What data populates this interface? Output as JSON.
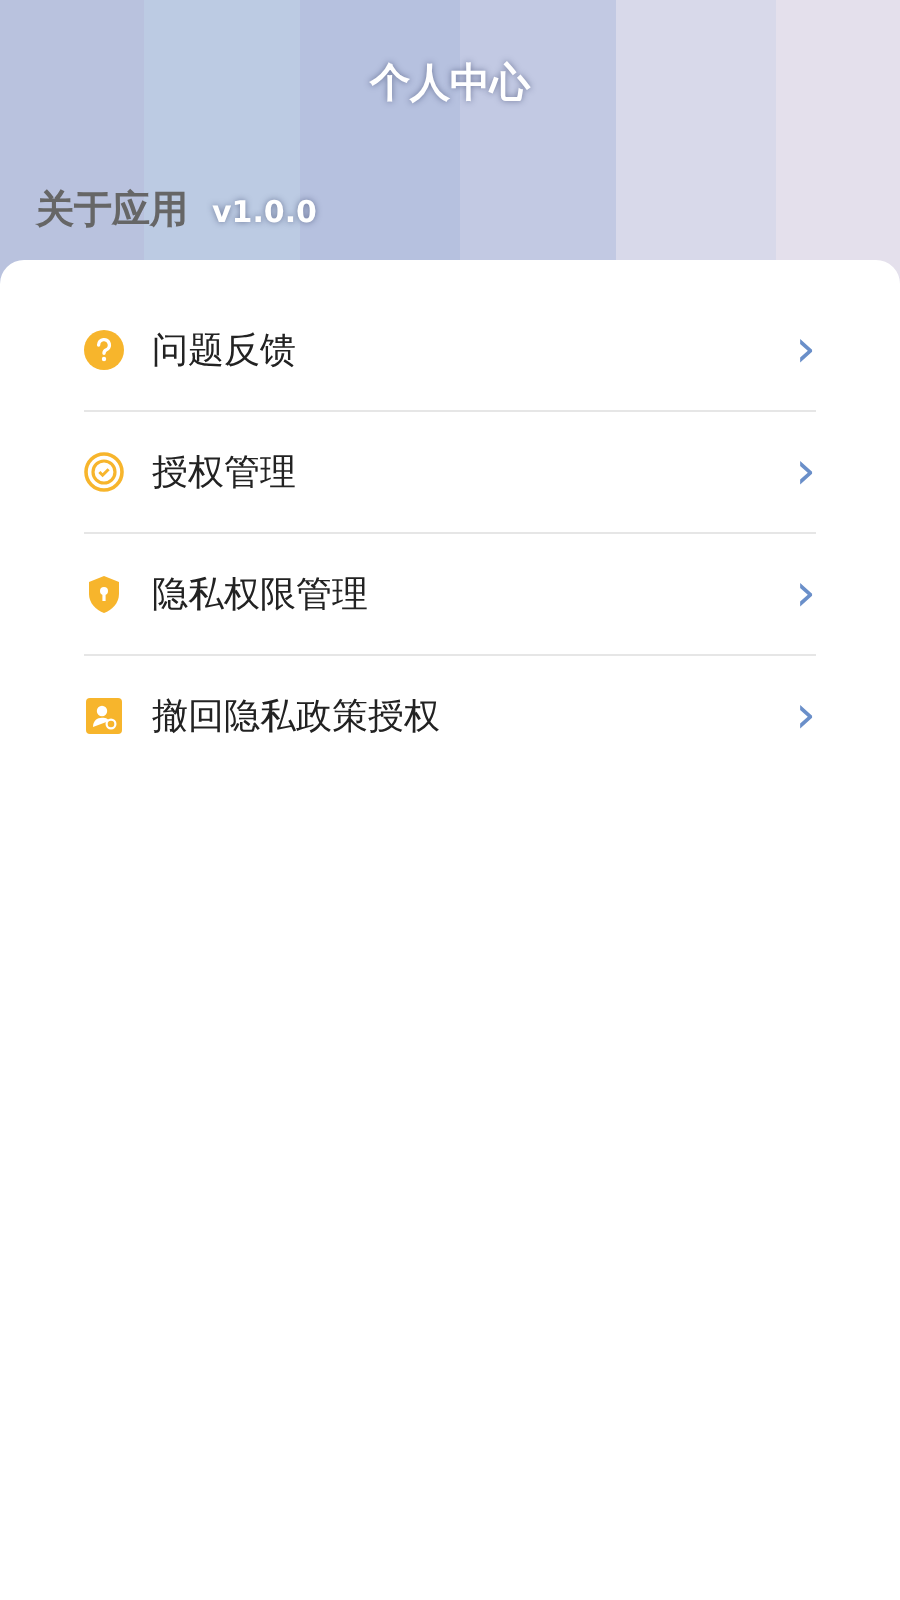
{
  "header": {
    "title": "个人中心",
    "about": {
      "label": "关于应用",
      "version": "v1.0.0"
    }
  },
  "menu": [
    {
      "kind": "question",
      "label": "问题反馈",
      "chevron": "›"
    },
    {
      "kind": "badge",
      "label": "授权管理",
      "chevron": "›"
    },
    {
      "kind": "shield",
      "label": "隐私权限管理",
      "chevron": "›"
    },
    {
      "kind": "person",
      "label": "撤回隐私政策授权",
      "chevron": "›"
    }
  ]
}
